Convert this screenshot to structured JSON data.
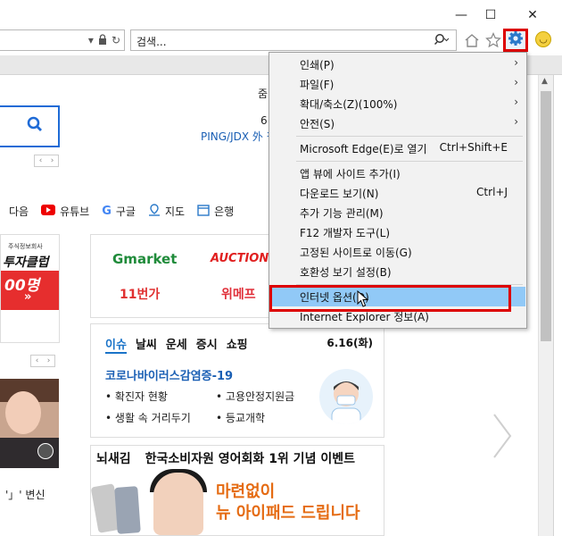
{
  "window": {
    "minimize_glyph": "—",
    "maximize_glyph": "☐",
    "close_glyph": "✕"
  },
  "address": {
    "dropdown_icon": "chevron-down-icon",
    "lock_icon": "lock-icon",
    "refresh_icon": "refresh-icon"
  },
  "search": {
    "placeholder": "검색...",
    "icon": "search-icon"
  },
  "toolbar": {
    "home_icon": "home-icon",
    "favorites_icon": "star-icon",
    "tools_icon": "gear-icon",
    "feedback_icon": "smiley-icon",
    "tools_highlight_color": "#dd0000"
  },
  "menu": {
    "items": [
      {
        "label": "인쇄(P)",
        "submenu": true
      },
      {
        "label": "파일(F)",
        "submenu": true
      },
      {
        "label": "확대/축소(Z)(100%)",
        "submenu": true
      },
      {
        "label": "안전(S)",
        "submenu": true
      },
      {
        "label": "Microsoft Edge(E)로 열기",
        "shortcut": "Ctrl+Shift+E"
      },
      {
        "label": "앱 뷰에 사이트 추가(I)"
      },
      {
        "label": "다운로드 보기(N)",
        "shortcut": "Ctrl+J"
      },
      {
        "label": "추가 기능 관리(M)"
      },
      {
        "label": "F12 개발자 도구(L)"
      },
      {
        "label": "고정된 사이트로 이동(G)"
      },
      {
        "label": "호환성 보기 설정(B)"
      },
      {
        "label": "인터넷 옵션(O)",
        "highlighted": true
      },
      {
        "label": "Internet Explorer 정보(A)"
      }
    ],
    "highlight_color": "#91c9f7",
    "annotation_color": "#dd0000"
  },
  "page": {
    "top_right_1": "줌",
    "top_right_2": "6",
    "top_right_3": "PING/JDX 外 핑",
    "nav": [
      {
        "label": "다음",
        "icon": ""
      },
      {
        "label": "유튜브",
        "icon": "youtube-icon"
      },
      {
        "label": "구글",
        "icon": "google-icon"
      },
      {
        "label": "지도",
        "icon": "map-icon"
      },
      {
        "label": "은행",
        "icon": "bank-icon"
      }
    ],
    "left_ad": {
      "small": "주식정보회사",
      "big": "투자클럽",
      "count": "00명",
      "arrow": "»"
    },
    "shopping": [
      {
        "name": "Gmarket",
        "color": "#1f8b3a"
      },
      {
        "name": "AUCTION.",
        "color": "#e02020"
      },
      {
        "name": "11번가",
        "color": "#e03030"
      },
      {
        "name": "위메프",
        "color": "#e0303a"
      }
    ],
    "issue": {
      "tabs": [
        "이슈",
        "날씨",
        "운세",
        "증시",
        "쇼핑"
      ],
      "date": "6.16(화)",
      "headline": "코로나바이러스감염증-19",
      "bullets": [
        "확진자 현황",
        "고용안정지원금",
        "생활 속 거리두기",
        "등교개학"
      ]
    },
    "news_left": "'」' 변신",
    "ad2": {
      "brand": "뇌새김",
      "title": "한국소비자원 영어회화 1위 기념 이벤트",
      "promo_1": "마련없이",
      "promo_2": "뉴 아이패드 드립니다"
    }
  }
}
